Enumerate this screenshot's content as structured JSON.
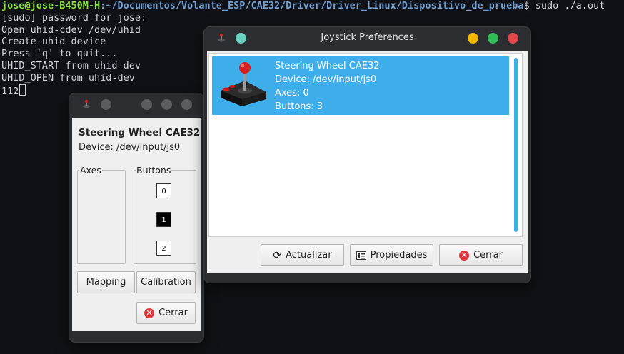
{
  "terminal": {
    "prompt_user": "jose@jose-B450M-H",
    "prompt_path": ":~/Documentos/Volante_ESP/CAE32/Driver/Driver_Linux/Dispositivo_de_prueba",
    "prompt_cmd": "$ sudo ./a.out",
    "lines": [
      "[sudo] password for jose:",
      "Open uhid-cdev /dev/uhid",
      "Create uhid device",
      "Press 'q' to quit...",
      "UHID_START from uhid-dev",
      "UHID_OPEN from uhid-dev",
      "112"
    ]
  },
  "test_window": {
    "device_name": "Steering Wheel CAE32",
    "device_path": "Device: /dev/input/js0",
    "axes_label": "Axes",
    "buttons_label": "Buttons",
    "buttons": [
      {
        "label": "0",
        "pressed": false
      },
      {
        "label": "1",
        "pressed": true
      },
      {
        "label": "2",
        "pressed": false
      }
    ],
    "mapping_label": "Mapping",
    "calibration_label": "Calibration",
    "close_label": "Cerrar"
  },
  "prefs_window": {
    "title": "Joystick Preferences",
    "device": {
      "name": "Steering Wheel CAE32",
      "path": "Device: /dev/input/js0",
      "axes": "Axes: 0",
      "buttons": "Buttons: 3"
    },
    "refresh_label": "Actualizar",
    "properties_label": "Propiedades",
    "close_label": "Cerrar"
  },
  "colors": {
    "selection": "#3daee9",
    "minimize": "#f5b800",
    "maximize": "#2fbf56",
    "close": "#e5474d",
    "keep_above": "#6cd0c0"
  }
}
